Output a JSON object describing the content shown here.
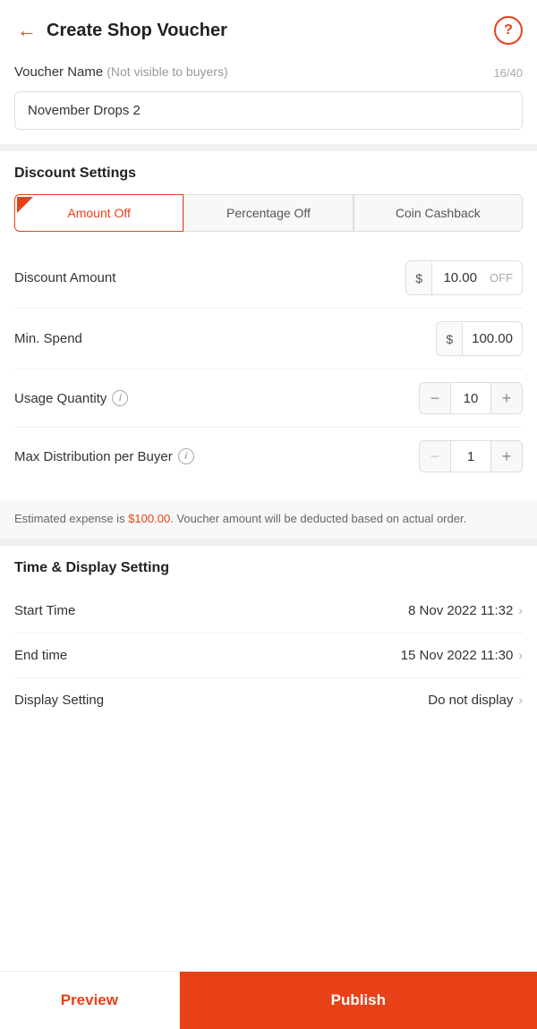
{
  "header": {
    "title": "Create Shop Voucher",
    "back_icon": "←",
    "help_icon": "?"
  },
  "voucher_name": {
    "label": "Voucher Name",
    "sub_label": "(Not visible to buyers)",
    "char_count": "16/40",
    "value": "November Drops 2"
  },
  "discount_settings": {
    "title": "Discount Settings",
    "tabs": [
      {
        "id": "amount_off",
        "label": "Amount Off",
        "active": true
      },
      {
        "id": "percentage_off",
        "label": "Percentage Off",
        "active": false
      },
      {
        "id": "coin_cashback",
        "label": "Coin Cashback",
        "active": false
      }
    ],
    "discount_amount": {
      "label": "Discount Amount",
      "currency": "$",
      "value": "10.00",
      "suffix": "OFF"
    },
    "min_spend": {
      "label": "Min. Spend",
      "currency": "$",
      "value": "100.00"
    },
    "usage_quantity": {
      "label": "Usage Quantity",
      "has_info": true,
      "value": 10,
      "min_disabled": false
    },
    "max_distribution": {
      "label": "Max Distribution per Buyer",
      "has_info": true,
      "value": 1,
      "min_disabled": true
    }
  },
  "expense_banner": {
    "text_prefix": "Estimated expense is ",
    "amount": "$100.00",
    "text_suffix": ". Voucher amount will be deducted based on actual order."
  },
  "time_display": {
    "title": "Time & Display Setting",
    "start_time": {
      "label": "Start Time",
      "value": "8 Nov 2022 11:32"
    },
    "end_time": {
      "label": "End time",
      "value": "15 Nov 2022 11:30"
    },
    "display_setting": {
      "label": "Display Setting",
      "value": "Do not display"
    }
  },
  "buttons": {
    "preview": "Preview",
    "publish": "Publish"
  },
  "colors": {
    "primary": "#e84118",
    "text_dark": "#222",
    "text_medium": "#555",
    "text_light": "#aaa"
  }
}
